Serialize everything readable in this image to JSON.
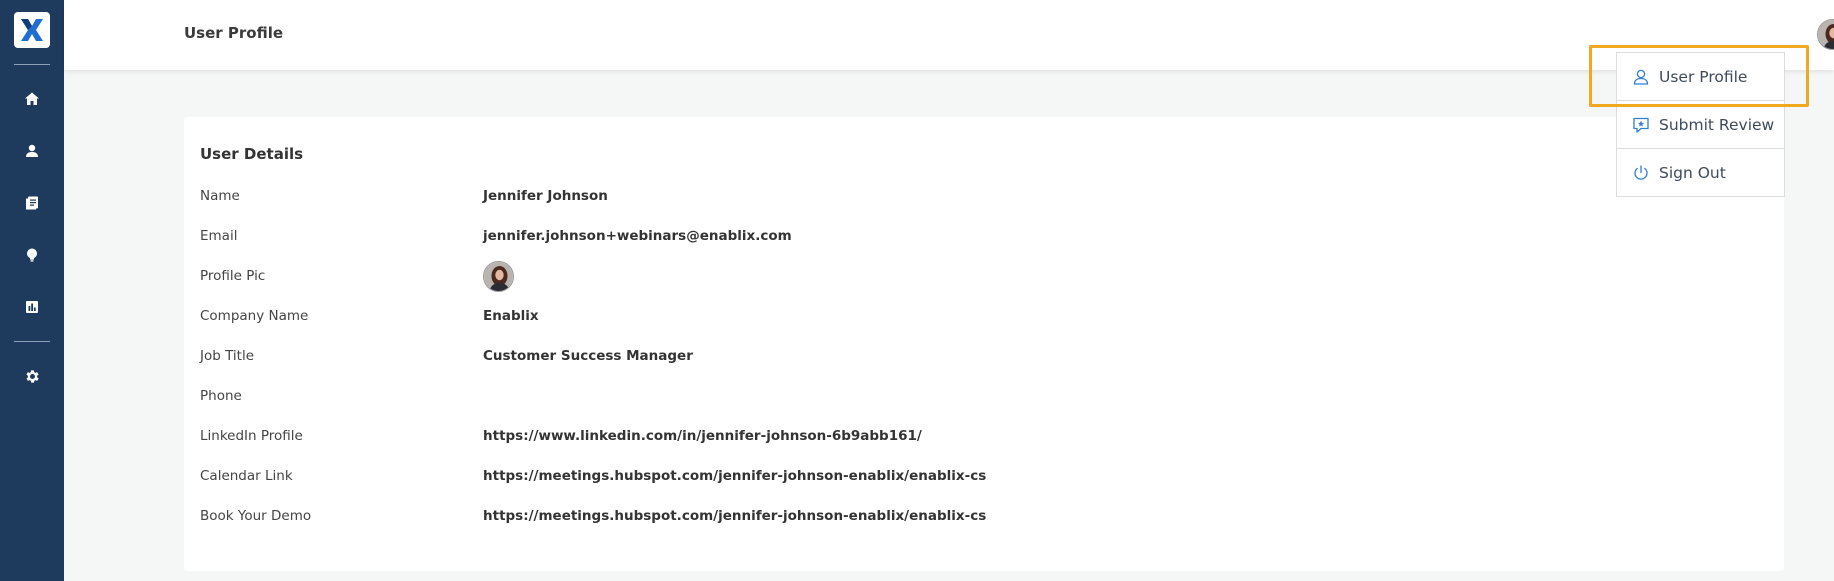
{
  "header": {
    "title": "User Profile"
  },
  "sidebar": {
    "logo_letter": "X",
    "items": [
      {
        "icon": "home-icon"
      },
      {
        "icon": "user-icon"
      },
      {
        "icon": "document-icon"
      },
      {
        "icon": "lightbulb-icon"
      },
      {
        "icon": "chart-icon"
      },
      {
        "icon": "gear-icon"
      }
    ]
  },
  "card": {
    "heading": "User Details",
    "rows": [
      {
        "label": "Name",
        "value": "Jennifer Johnson"
      },
      {
        "label": "Email",
        "value": "jennifer.johnson+webinars@enablix.com"
      },
      {
        "label": "Profile Pic",
        "value": ""
      },
      {
        "label": "Company Name",
        "value": "Enablix"
      },
      {
        "label": "Job Title",
        "value": "Customer Success Manager"
      },
      {
        "label": "Phone",
        "value": ""
      },
      {
        "label": "LinkedIn Profile",
        "value": "https://www.linkedin.com/in/jennifer-johnson-6b9abb161/"
      },
      {
        "label": "Calendar Link",
        "value": "https://meetings.hubspot.com/jennifer-johnson-enablix/enablix-cs"
      },
      {
        "label": "Book Your Demo",
        "value": "https://meetings.hubspot.com/jennifer-johnson-enablix/enablix-cs"
      }
    ]
  },
  "dropdown": {
    "items": [
      {
        "label": "User Profile",
        "icon": "user-outline-icon"
      },
      {
        "label": "Submit Review",
        "icon": "review-icon"
      },
      {
        "label": "Sign Out",
        "icon": "power-icon"
      }
    ]
  },
  "colors": {
    "sidebar_bg": "#1e3a5c",
    "accent": "#2f7fd1",
    "highlight": "#f0a821"
  }
}
